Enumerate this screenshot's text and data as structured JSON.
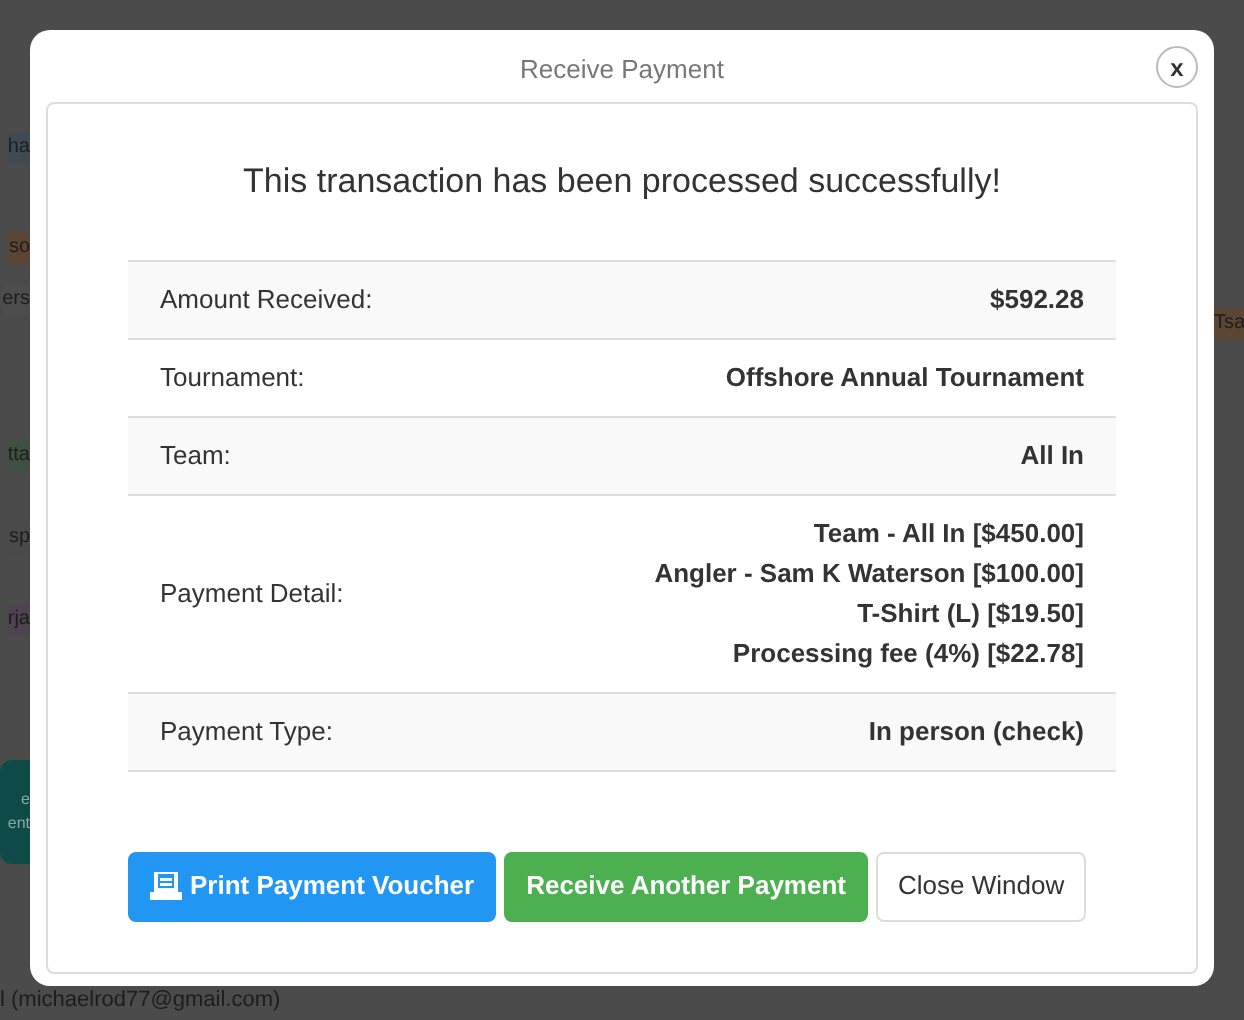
{
  "background": {
    "left_fragments": [
      {
        "text": "ha",
        "color": "#3f4a52"
      },
      {
        "text": "so",
        "color": "#5a4633"
      },
      {
        "text": "ers",
        "color": "#4d4d4d"
      },
      {
        "text": "tta",
        "color": "#3f5142"
      },
      {
        "text": "sp",
        "color": "#4a4a4a"
      },
      {
        "text": "rja",
        "color": "#4f4352"
      }
    ],
    "left_button": [
      "e",
      "ent"
    ],
    "right_fragment": {
      "text": "Tsa",
      "color": "#5a4633"
    },
    "bottom_text": "l (michaelrod77@gmail.com)"
  },
  "dialog": {
    "title": "Receive Payment",
    "close": "x",
    "message": "This transaction has been processed successfully!",
    "rows": [
      {
        "label": "Amount Received:",
        "values": [
          "$592.28"
        ]
      },
      {
        "label": "Tournament:",
        "values": [
          "Offshore Annual Tournament"
        ]
      },
      {
        "label": "Team:",
        "values": [
          "All In"
        ]
      },
      {
        "label": "Payment Detail:",
        "values": [
          "Team - All In [$450.00]",
          "Angler - Sam K Waterson [$100.00]",
          "T-Shirt (L) [$19.50]",
          "Processing fee (4%) [$22.78]"
        ]
      },
      {
        "label": "Payment Type:",
        "values": [
          "In person (check)"
        ]
      }
    ],
    "buttons": [
      {
        "label": "Print Payment Voucher",
        "kind": "primary"
      },
      {
        "label": "Receive Another Payment",
        "kind": "success"
      },
      {
        "label": "Close Window",
        "kind": "default"
      }
    ]
  }
}
